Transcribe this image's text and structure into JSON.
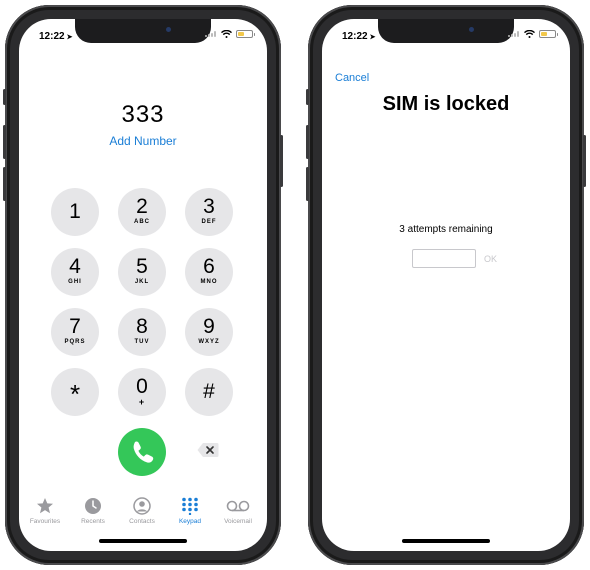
{
  "left_phone": {
    "status": {
      "time": "12:22"
    },
    "dialed_number": "333",
    "add_number_label": "Add Number",
    "keys": [
      {
        "digit": "1",
        "letters": ""
      },
      {
        "digit": "2",
        "letters": "ABC"
      },
      {
        "digit": "3",
        "letters": "DEF"
      },
      {
        "digit": "4",
        "letters": "GHI"
      },
      {
        "digit": "5",
        "letters": "JKL"
      },
      {
        "digit": "6",
        "letters": "MNO"
      },
      {
        "digit": "7",
        "letters": "PQRS"
      },
      {
        "digit": "8",
        "letters": "TUV"
      },
      {
        "digit": "9",
        "letters": "WXYZ"
      },
      {
        "digit": "*",
        "letters": ""
      },
      {
        "digit": "0",
        "letters": "+"
      },
      {
        "digit": "#",
        "letters": ""
      }
    ],
    "tabs": [
      {
        "label": "Favourites",
        "icon": "star-icon"
      },
      {
        "label": "Recents",
        "icon": "clock-icon"
      },
      {
        "label": "Contacts",
        "icon": "person-circle-icon"
      },
      {
        "label": "Keypad",
        "icon": "keypad-icon",
        "active": true
      },
      {
        "label": "Voicemail",
        "icon": "voicemail-icon"
      }
    ],
    "colors": {
      "accent": "#1a7ed6",
      "call": "#34c759",
      "key": "#e6e6e8"
    }
  },
  "right_phone": {
    "status": {
      "time": "12:22"
    },
    "cancel_label": "Cancel",
    "title": "SIM is locked",
    "attempts_text": "3 attempts remaining",
    "pin_input": {
      "value": "",
      "placeholder": ""
    },
    "ok_label": "OK"
  }
}
